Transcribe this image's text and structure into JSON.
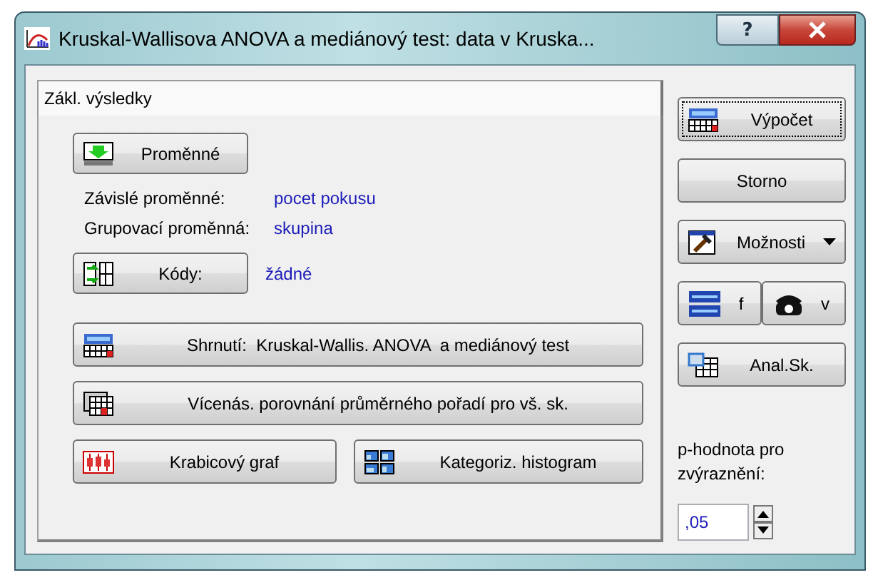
{
  "window": {
    "title": "Kruskal-Wallisova ANOVA a mediánový test: data v Kruska...",
    "help": "?"
  },
  "tabs": [
    {
      "label": "Zákl. výsledky",
      "selected": true
    }
  ],
  "variables_button": {
    "label": "Proměnné"
  },
  "fields": [
    {
      "label": "Závislé proměnné:",
      "value": "pocet pokusu"
    },
    {
      "label": "Grupovací proměnná:",
      "value": "skupina"
    }
  ],
  "codes": {
    "label": "Kódy:",
    "value": "žádné"
  },
  "result_buttons": [
    {
      "label": "Shrnutí:  Kruskal-Wallis. ANOVA  a mediánový test"
    },
    {
      "label": "Vícenás. porovnání průměrného pořadí pro vš. sk."
    }
  ],
  "graph_buttons": [
    {
      "label": "Krabicový graf"
    },
    {
      "label": "Kategoriz. histogram"
    }
  ],
  "side_buttons": [
    {
      "kind": "button",
      "label": "Výpočet",
      "focused": true
    },
    {
      "kind": "button",
      "label": "Storno",
      "focused": false
    },
    {
      "kind": "dropdown",
      "label": "Možnosti"
    },
    {
      "kind": "pair",
      "buttons": [
        {
          "label": "f"
        },
        {
          "label": "v"
        }
      ]
    },
    {
      "kind": "button",
      "label": "Anal.Sk.",
      "focused": false
    }
  ],
  "p_value": {
    "label": "p-hodnota pro zvýraznění:",
    "value": ",05"
  }
}
